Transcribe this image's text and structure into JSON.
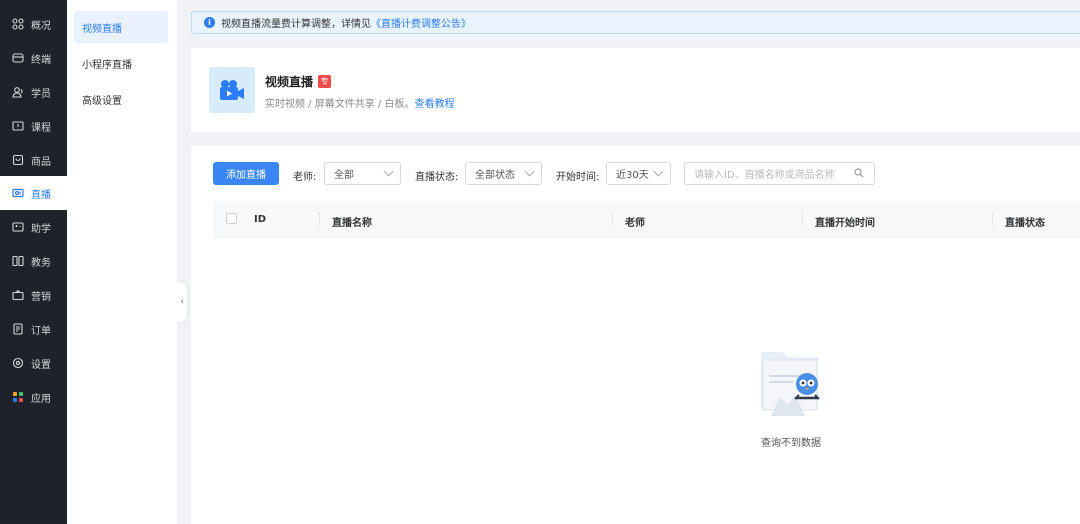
{
  "nav": {
    "items": [
      {
        "label": "概况",
        "icon": "overview-icon"
      },
      {
        "label": "终端",
        "icon": "terminal-icon"
      },
      {
        "label": "学员",
        "icon": "students-icon"
      },
      {
        "label": "课程",
        "icon": "course-icon"
      },
      {
        "label": "商品",
        "icon": "goods-icon"
      },
      {
        "label": "直播",
        "icon": "live-icon"
      },
      {
        "label": "助学",
        "icon": "assist-icon"
      },
      {
        "label": "教务",
        "icon": "academic-icon"
      },
      {
        "label": "营销",
        "icon": "marketing-icon"
      },
      {
        "label": "订单",
        "icon": "order-icon"
      },
      {
        "label": "设置",
        "icon": "settings-icon"
      },
      {
        "label": "应用",
        "icon": "apps-icon"
      }
    ],
    "active": "直播"
  },
  "subnav": {
    "items": [
      {
        "label": "视频直播"
      },
      {
        "label": "小程序直播"
      },
      {
        "label": "高级设置"
      }
    ],
    "active": "视频直播"
  },
  "notice": {
    "text": "视频直播流量费计算调整，详情见",
    "link": "《直播计费调整公告》"
  },
  "header": {
    "title": "视频直播",
    "badge": "专",
    "desc": "实时视频 / 屏幕文件共享 / 白板。",
    "desc_link": "查看教程"
  },
  "toolbar": {
    "add_label": "添加直播",
    "teacher_label": "老师:",
    "teacher_value": "全部",
    "status_label": "直播状态:",
    "status_value": "全部状态",
    "time_label": "开始时间:",
    "time_value": "近30天",
    "search_placeholder": "请输入ID、直播名称或商品名称"
  },
  "table": {
    "columns": [
      "ID",
      "直播名称",
      "老师",
      "直播开始时间",
      "直播状态"
    ],
    "rows": []
  },
  "empty": {
    "text": "查询不到数据"
  },
  "colors": {
    "accent": "#2b7cf6",
    "sidebar_bg": "#1f2228",
    "badge": "#f04b4b"
  }
}
